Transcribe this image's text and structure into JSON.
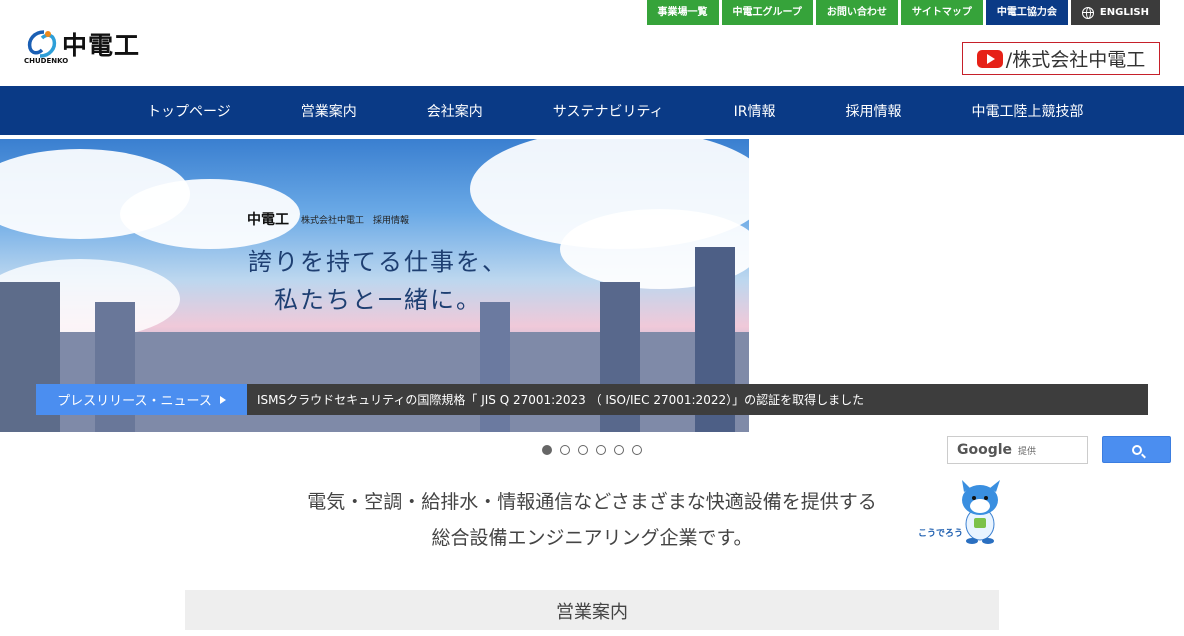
{
  "header": {
    "logo_text": "中電工",
    "logo_sub": "CHUDENKO",
    "top_links": [
      {
        "label": "事業場一覧",
        "name": "link-offices"
      },
      {
        "label": "中電工グループ",
        "name": "link-group"
      },
      {
        "label": "お問い合わせ",
        "name": "link-contact"
      },
      {
        "label": "サイトマップ",
        "name": "link-sitemap"
      },
      {
        "label": "中電工協力会",
        "name": "link-cooperative"
      },
      {
        "label": "ENGLISH",
        "name": "link-english"
      }
    ],
    "youtube_label": "/株式会社中電工"
  },
  "nav": {
    "items": [
      "トップページ",
      "営業案内",
      "会社案内",
      "サステナビリティ",
      "IR情報",
      "採用情報",
      "中電工陸上競技部"
    ]
  },
  "hero": {
    "logo_brand": "中電工",
    "logo_sub": "株式会社中電工　採用情報",
    "catch_line1": "誇りを持てる仕事を、",
    "catch_line2": "私たちと一緒に。",
    "news_tag": "プレスリリース・ニュース",
    "news_text": "ISMSクラウドセキュリティの国際規格「 JIS Q 27001:2023 （ ISO/IEC 27001:2022）」の認証を取得しました",
    "slide_count": 6,
    "active_slide": 1
  },
  "search": {
    "provider": "Google",
    "provider_suffix": "提供"
  },
  "tagline": {
    "line1": "電気・空調・給排水・情報通信などさまざまな快適設備を提供する",
    "line2": "総合設備エンジニアリング企業です。"
  },
  "mascot": {
    "name": "こうでろう"
  },
  "section": {
    "title": "営業案内"
  },
  "colors": {
    "nav_blue": "#0a3a86",
    "link_green": "#36a33a",
    "accent_blue": "#4b8ef0",
    "youtube_red": "#e62117"
  }
}
